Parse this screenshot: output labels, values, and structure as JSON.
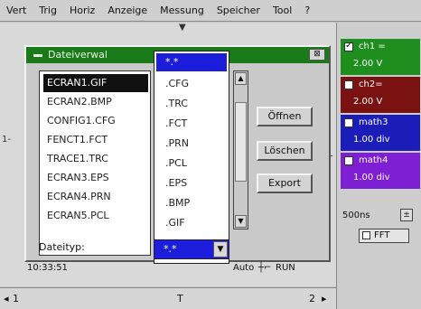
{
  "menu": [
    "Vert",
    "Trig",
    "Horiz",
    "Anzeige",
    "Messung",
    "Speicher",
    "Tool",
    "?"
  ],
  "dialog": {
    "title": "Dateiverwal",
    "close": "⊠",
    "files": [
      "ECRAN1.GIF",
      "ECRAN2.BMP",
      "CONFIG1.CFG",
      "FENCT1.FCT",
      "TRACE1.TRC",
      "ECRAN3.EPS",
      "ECRAN4.PRN",
      "ECRAN5.PCL"
    ],
    "extensions": [
      "*.*",
      ".CFG",
      ".TRC",
      ".FCT",
      ".PRN",
      ".PCL",
      ".EPS",
      ".BMP",
      ".GIF"
    ],
    "buttons": {
      "open": "Öffnen",
      "delete": "Löschen",
      "export": "Export"
    },
    "filetype_label": "Dateityp:",
    "filetype_value": "*.*"
  },
  "status": {
    "time": "10:33:51",
    "mode": "Auto",
    "run": "RUN"
  },
  "bottom": {
    "left": "1",
    "mid": "T",
    "right": "2"
  },
  "channels": [
    {
      "name": "ch1 =",
      "scale": "2.00 V",
      "color": "#1e8f1e",
      "checked": true
    },
    {
      "name": "ch2=",
      "scale": "2.00 V",
      "color": "#7a1212",
      "checked": false
    },
    {
      "name": "math3",
      "scale": "1.00 div",
      "color": "#1c1cb8",
      "checked": false
    },
    {
      "name": "math4",
      "scale": "1.00 div",
      "color": "#7e1fd4",
      "checked": false
    }
  ],
  "sdiv": "500ns",
  "fft_label": "FFT"
}
